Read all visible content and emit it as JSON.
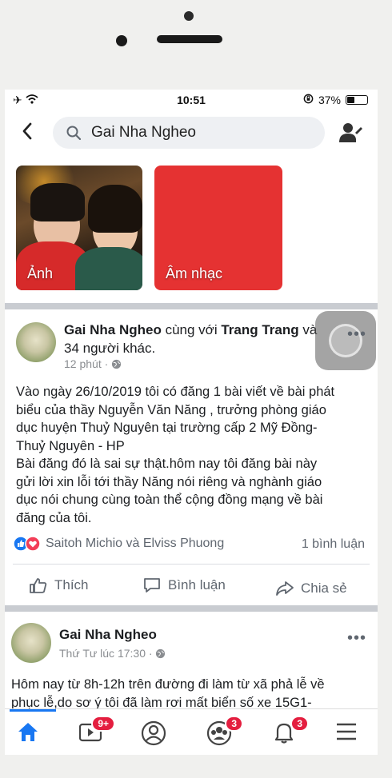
{
  "status": {
    "time": "10:51",
    "battery": "37%",
    "battery_level": 0.37
  },
  "search": {
    "query": "Gai Nha Ngheo"
  },
  "tiles": [
    {
      "label": "Ảnh"
    },
    {
      "label": "Âm nhạc"
    }
  ],
  "post1": {
    "author": "Gai Nha Ngheo",
    "with_text": " cùng với ",
    "tagged": "Trang Trang",
    "and_text": " và",
    "others": "34 người khác.",
    "time": "12 phút · ",
    "body_lines": [
      "Vào ngày 26/10/2019 tôi có đăng 1 bài viết về bài phát",
      "biểu của thầy Nguyễn Văn Năng , trưởng phòng giáo",
      "dục huyện Thuỷ Nguyên tại trường cấp 2 Mỹ Đồng-",
      "Thuỷ Nguyên - HP",
      "Bài đăng đó là sai sự thật.hôm nay tôi đăng bài này",
      "gửi lời xin lỗi tới thầy Năng nói riêng và nghành giáo",
      "dục nói chung cùng toàn thể cộng đồng mạng về bài",
      "đăng của tôi."
    ],
    "reactions": "Saitoh Michio và Elviss Phuong",
    "comments": "1 bình luận",
    "like": "Thích",
    "comment": "Bình luận",
    "share": "Chia sẻ"
  },
  "post2": {
    "author": "Gai Nha Ngheo",
    "time": "Thứ Tư lúc 17:30 · ",
    "body_lines": [
      "Hôm nay từ 8h-12h trên đường đi làm từ xã phả lễ về",
      "phục lễ,do sơ ý tôi đã làm rơi mất biển số xe 15G1-"
    ]
  },
  "tabbar": {
    "watch_badge": "9+",
    "groups_badge": "3",
    "notifications_badge": "3"
  },
  "colors": {
    "accent": "#1877f2",
    "badge": "#e41e3f",
    "music_tile": "#e53232"
  }
}
